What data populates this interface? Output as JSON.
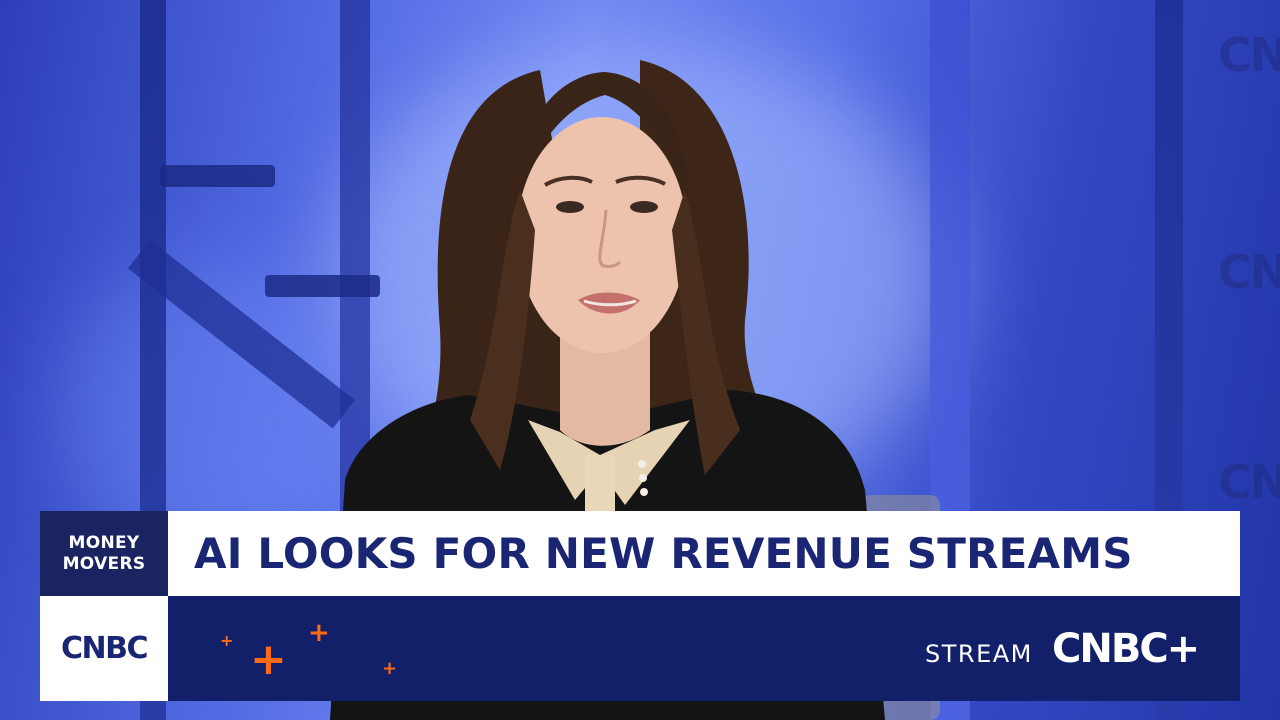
{
  "lower_third": {
    "show_name_line1": "MONEY",
    "show_name_line2": "MOVERS",
    "headline": "AI LOOKS FOR NEW REVENUE STREAMS",
    "network_logo": "CNBC",
    "promo_label": "STREAM",
    "promo_logo": "CNBC+",
    "decorative_plus": "+"
  },
  "background": {
    "watermark_text": "CNBC"
  },
  "colors": {
    "navy": "#1a2573",
    "promo_navy": "#12206a",
    "accent_orange": "#ff6a13",
    "backdrop_blue": "#4f67e0"
  }
}
